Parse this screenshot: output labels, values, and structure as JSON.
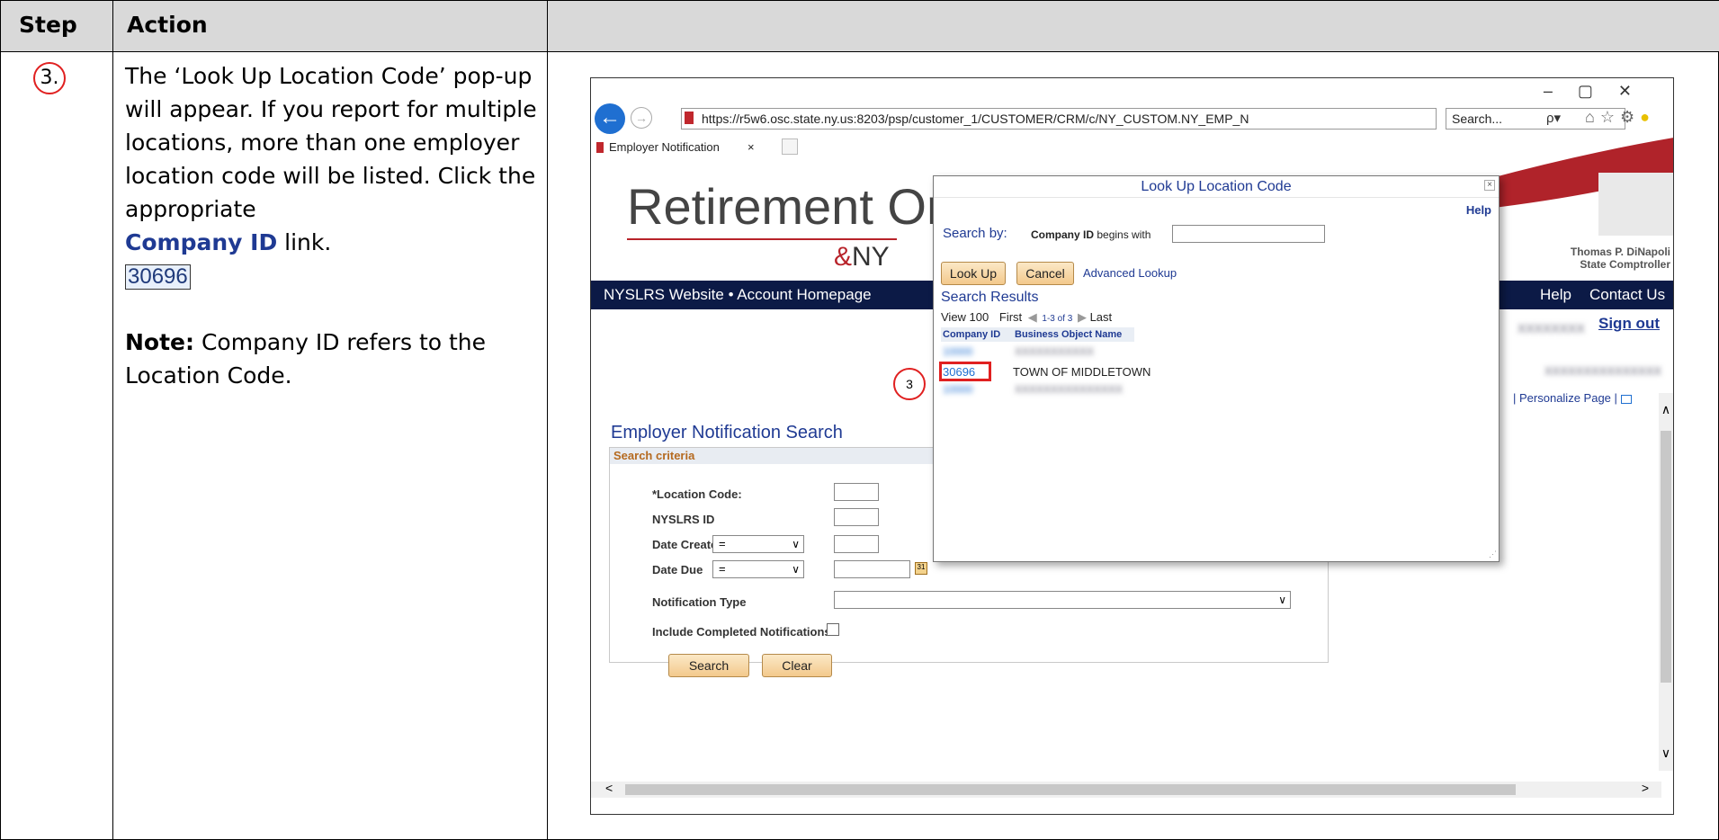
{
  "table": {
    "header": {
      "step": "Step",
      "action": "Action"
    },
    "row": {
      "step_number": "3.",
      "instruction_line1": "The ‘Look Up Location Code’ pop-up will appear. If you report for multiple locations, more than one employer location code will be listed. Click the appropriate",
      "instruction_bold": "Company ID",
      "instruction_line2": " link.",
      "sample_code": "30696",
      "note_label": "Note:",
      "note_text": " Company ID refers to the Location Code."
    }
  },
  "browser": {
    "url": "https://r5w6.osc.state.ny.us:8203/psp/customer_1/CUSTOMER/CRM/c/NY_CUSTOM.NY_EMP_N",
    "search_placeholder": "Search...",
    "tab_title": "Employer Notification",
    "search_dropdown": "ρ▾"
  },
  "page": {
    "logo_text": "Retirement On",
    "logo_sub": "NY",
    "comptroller_name": "Thomas P. DiNapoli",
    "comptroller_title": "State Comptroller",
    "nav_left": "NYSLRS Website  •  Account Homepage",
    "nav_help": "Help",
    "nav_contact": "Contact Us",
    "sign_out": "Sign out",
    "personalize": "Personalize Page",
    "title": "Employer Notification Search",
    "criteria_header": "Search criteria",
    "fields": {
      "location_code": "*Location Code:",
      "nyslrs_id": "NYSLRS ID",
      "date_created": "Date Created",
      "date_due": "Date Due",
      "notification_type": "Notification Type",
      "include_completed": "Include Completed Notifications:"
    },
    "equals": "=",
    "search_button": "Search",
    "clear_button": "Clear"
  },
  "popup": {
    "title": "Look Up Location Code",
    "help": "Help",
    "search_by_label": "Search by:",
    "search_field_label": "Company ID",
    "begins_with": "begins with",
    "lookup_button": "Look Up",
    "cancel_button": "Cancel",
    "advanced_lookup": "Advanced Lookup",
    "results_title": "Search Results",
    "view_100": "View 100",
    "first": "First",
    "range": "1-3 of 3",
    "last": "Last",
    "col_company_id": "Company ID",
    "col_business_name": "Business Object Name",
    "rows": [
      {
        "id": "10000",
        "name": "XXXXXXXXXXX"
      },
      {
        "id": "30696",
        "name": "TOWN OF MIDDLETOWN"
      },
      {
        "id": "10000",
        "name": "XXXXXXXXXXXXXXX"
      }
    ]
  },
  "callout": {
    "number": "3",
    "color": "#e02020"
  },
  "colors": {
    "navbar": "#0c1a46",
    "link": "#1f4fb0",
    "header_bg": "#d9d9d9"
  }
}
